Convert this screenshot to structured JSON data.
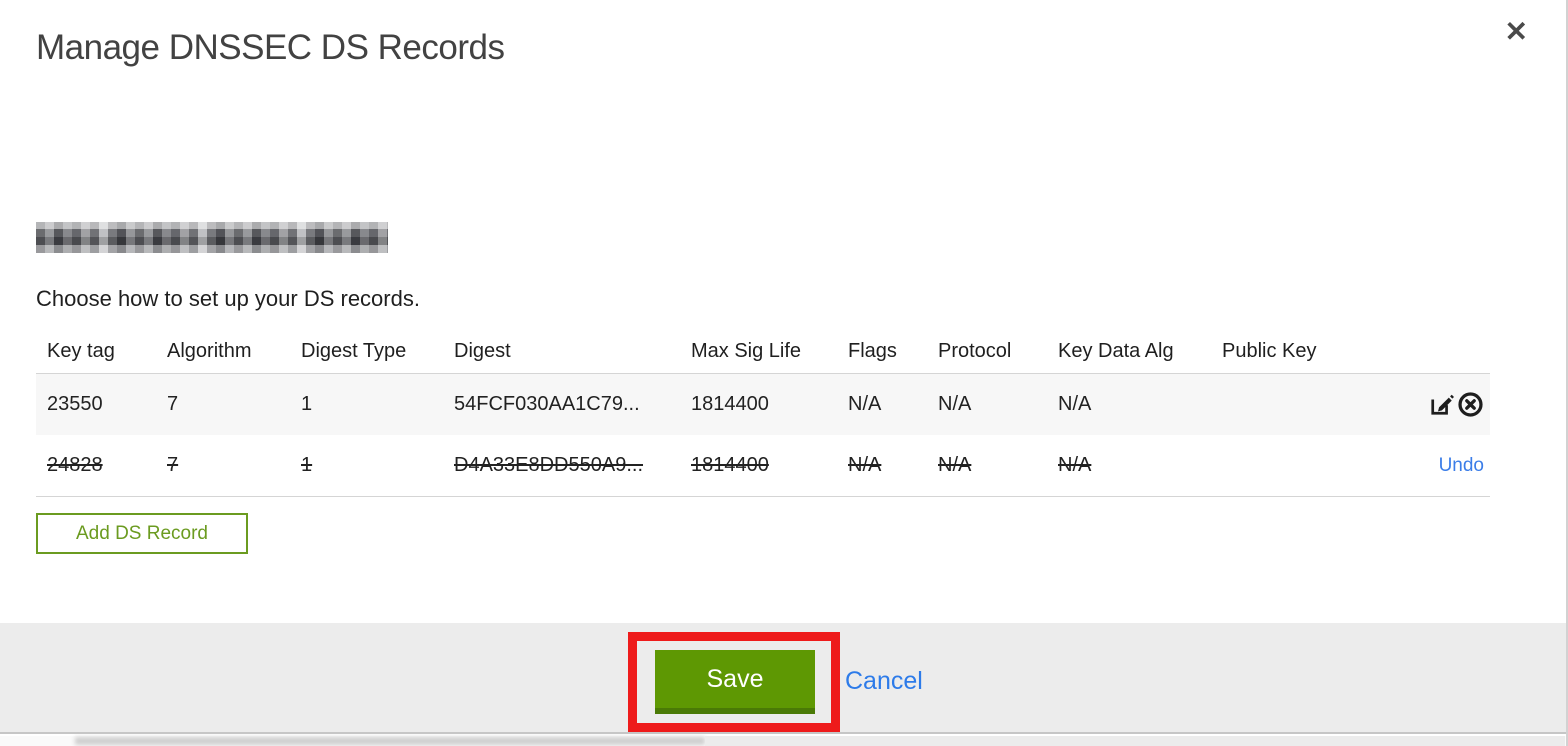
{
  "modal": {
    "title": "Manage DNSSEC DS Records",
    "close_glyph": "✕",
    "instruction": "Choose how to set up your DS records."
  },
  "table": {
    "columns": [
      "Key tag",
      "Algorithm",
      "Digest Type",
      "Digest",
      "Max Sig Life",
      "Flags",
      "Protocol",
      "Key Data Alg",
      "Public Key"
    ],
    "rows": [
      {
        "key_tag": "23550",
        "algorithm": "7",
        "digest_type": "1",
        "digest": "54FCF030AA1C79...",
        "max_sig_life": "1814400",
        "flags": "N/A",
        "protocol": "N/A",
        "key_data_alg": "N/A",
        "public_key": "",
        "state": "active"
      },
      {
        "key_tag": "24828",
        "algorithm": "7",
        "digest_type": "1",
        "digest": "D4A33E8DD550A9...",
        "max_sig_life": "1814400",
        "flags": "N/A",
        "protocol": "N/A",
        "key_data_alg": "N/A",
        "public_key": "",
        "state": "pending-delete",
        "undo_label": "Undo"
      }
    ]
  },
  "buttons": {
    "add_ds_record": "Add DS Record",
    "save": "Save",
    "cancel": "Cancel"
  },
  "colors": {
    "save_green": "#5e9803",
    "outline_green": "#6b9b20",
    "link_blue": "#2d7be9",
    "annotation_red": "#ee1b1b"
  }
}
